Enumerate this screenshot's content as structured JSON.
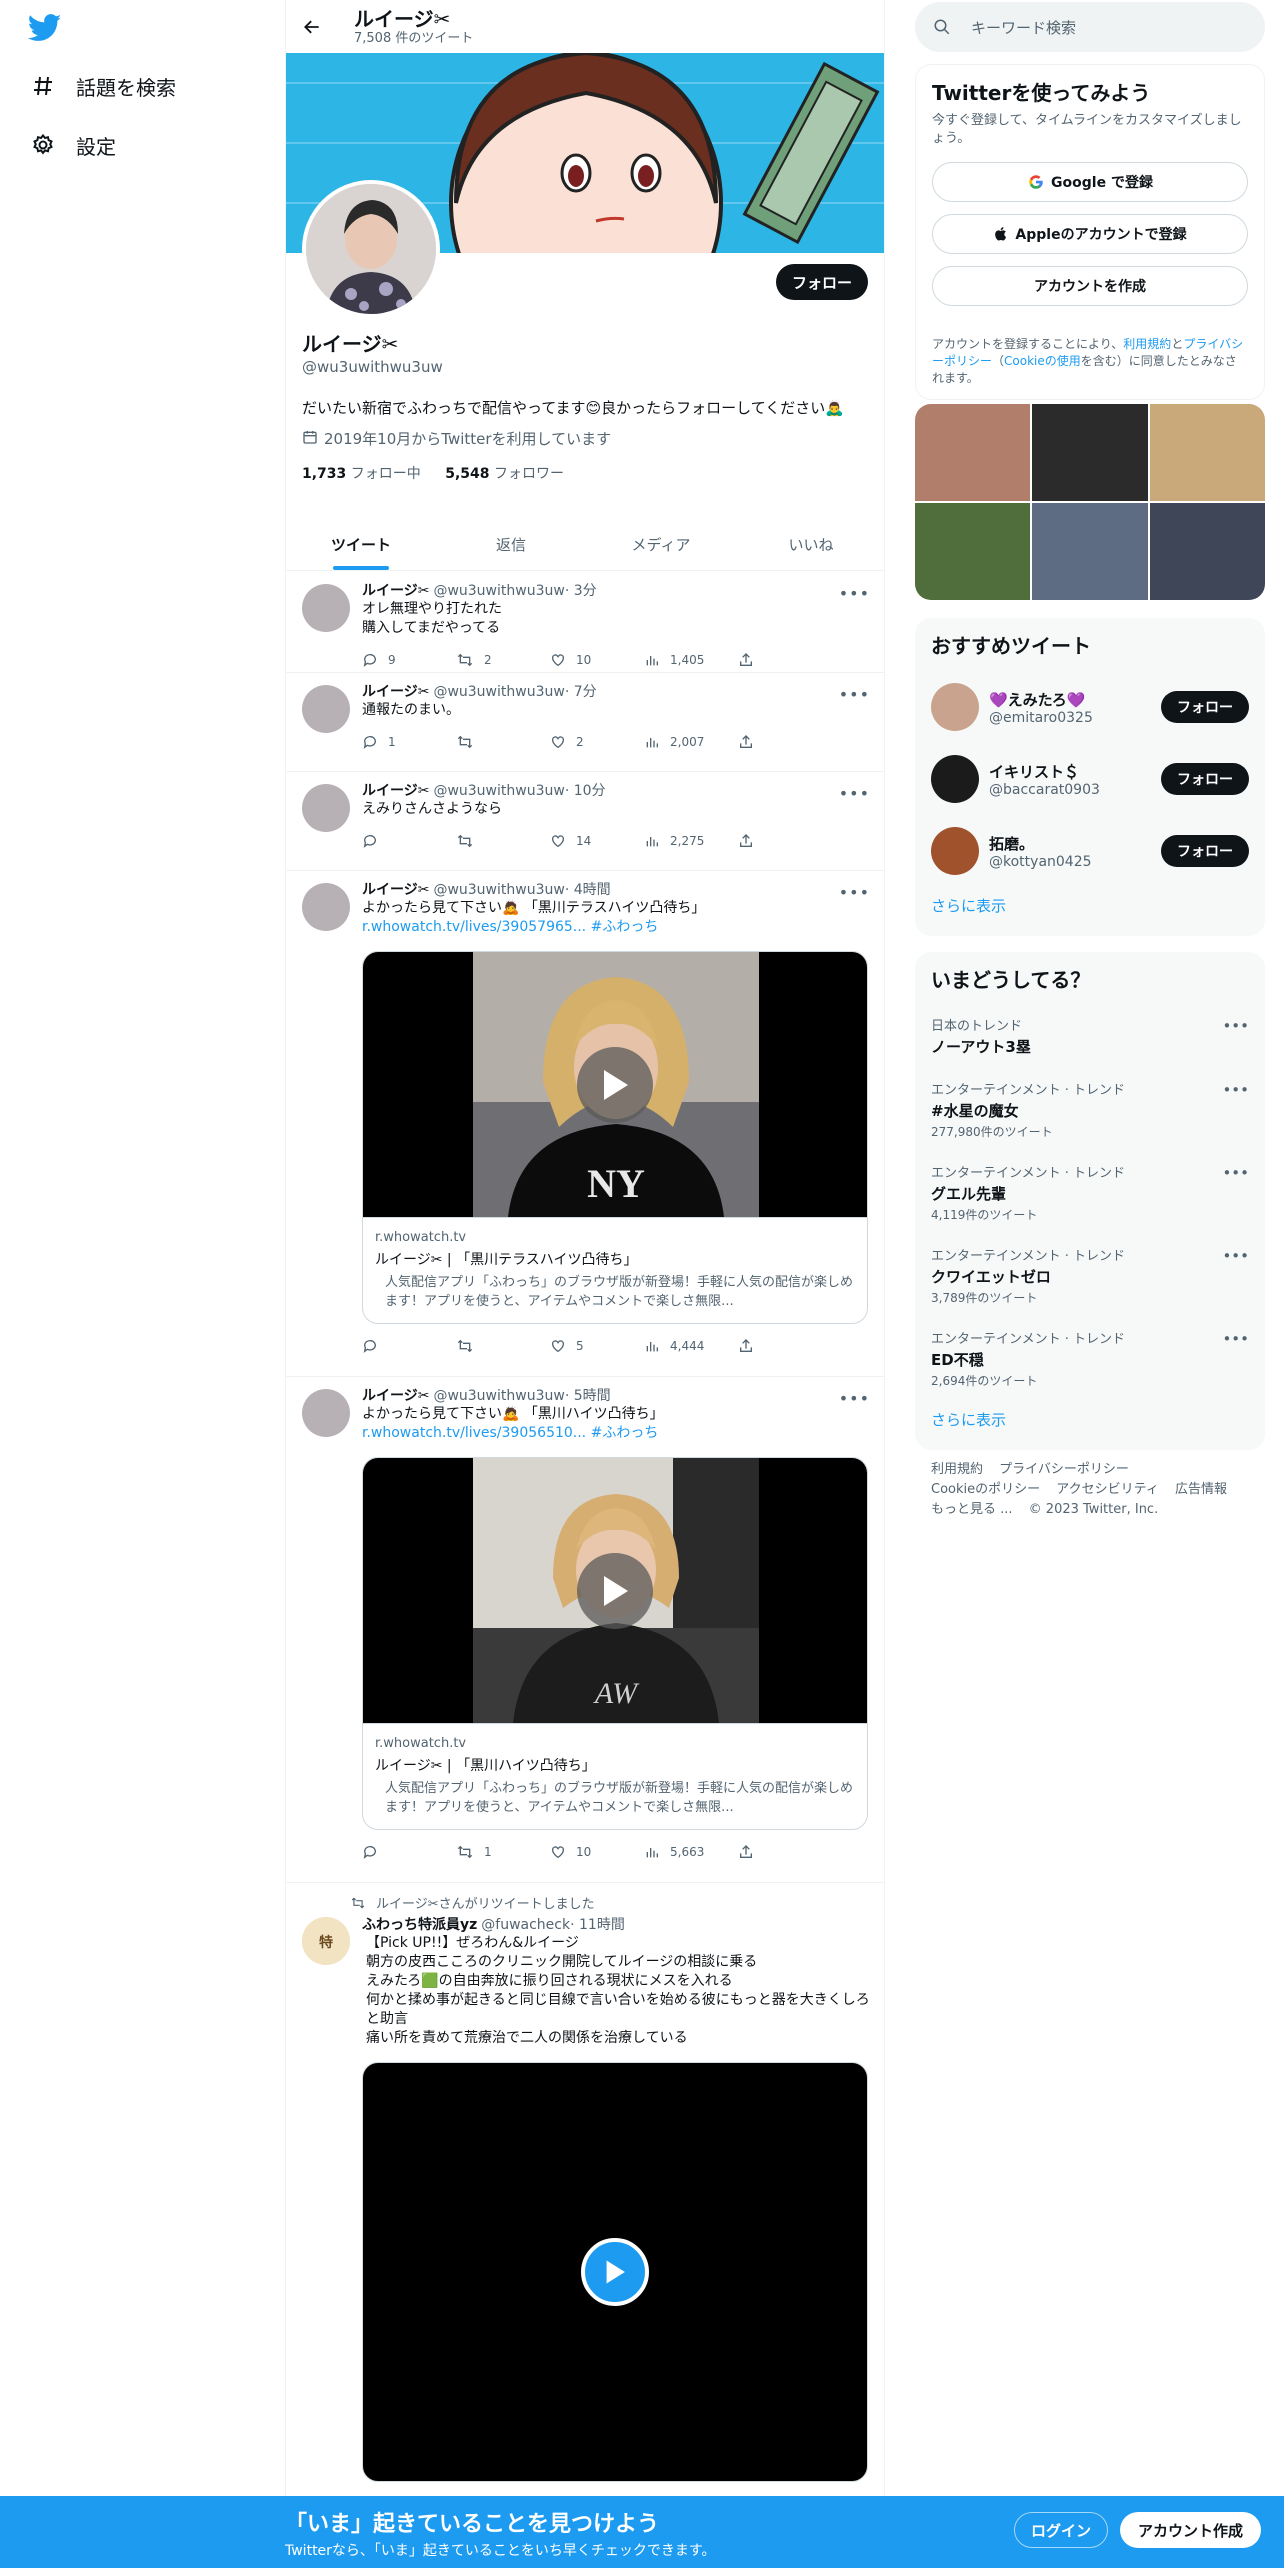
{
  "nav": {
    "explore_label": "話題を検索",
    "settings_label": "設定"
  },
  "header": {
    "name": "ルイージ✂︎",
    "tweet_count": "7,508 件のツイート"
  },
  "profile": {
    "follow_label": "フォロー",
    "name": "ルイージ✂︎",
    "handle": "@wu3uwithwu3uw",
    "bio": "だいたい新宿でふわっちで配信やってます😊良かったらフォローしてください🙇‍♂️",
    "joined": "2019年10月からTwitterを利用しています",
    "following_count": "1,733",
    "following_label": "フォロー中",
    "followers_count": "5,548",
    "followers_label": "フォロワー"
  },
  "tabs": [
    "ツイート",
    "返信",
    "メディア",
    "いいね"
  ],
  "tweets": [
    {
      "name": "ルイージ✂︎",
      "handle": "@wu3uwithwu3uw",
      "time": "· 3分",
      "text": "オレ無理やり打たれた\n購入してまだやってる",
      "replies": "9",
      "retweets": "2",
      "likes": "10",
      "views": "1,405"
    },
    {
      "name": "ルイージ✂︎",
      "handle": "@wu3uwithwu3uw",
      "time": "· 7分",
      "text": "通報たのまい。",
      "replies": "1",
      "retweets": "",
      "likes": "2",
      "views": "2,007"
    },
    {
      "name": "ルイージ✂︎",
      "handle": "@wu3uwithwu3uw",
      "time": "· 10分",
      "text": "えみりさんさようなら",
      "replies": "",
      "retweets": "",
      "likes": "14",
      "views": "2,275"
    },
    {
      "name": "ルイージ✂︎",
      "handle": "@wu3uwithwu3uw",
      "time": "· 4時間",
      "text": "よかったら見て下さい🙇 「黒川テラスハイツ凸待ち」",
      "link": "r.whowatch.tv/lives/39057965...",
      "hashtag": "#ふわっち",
      "card_domain": "r.whowatch.tv",
      "card_title": "ルイージ✂︎ | 「黒川テラスハイツ凸待ち」",
      "card_desc": "人気配信アプリ「ふわっち」のブラウザ版が新登場！手軽に人気の配信が楽しめます！アプリを使うと、アイテムやコメントで楽しさ無限...",
      "replies": "",
      "retweets": "",
      "likes": "5",
      "views": "4,444"
    },
    {
      "name": "ルイージ✂︎",
      "handle": "@wu3uwithwu3uw",
      "time": "· 5時間",
      "text": "よかったら見て下さい🙇 「黒川ハイツ凸待ち」",
      "link": "r.whowatch.tv/lives/39056510...",
      "hashtag": "#ふわっち",
      "card_domain": "r.whowatch.tv",
      "card_title": "ルイージ✂︎ | 「黒川ハイツ凸待ち」",
      "card_desc": "人気配信アプリ「ふわっち」のブラウザ版が新登場！手軽に人気の配信が楽しめます！アプリを使うと、アイテムやコメントで楽しさ無限...",
      "replies": "",
      "retweets": "1",
      "likes": "10",
      "views": "5,663"
    },
    {
      "retweet_note": "ルイージ✂︎さんがリツイートしました",
      "name": "ふわっち特派員yz",
      "handle": "@fuwacheck",
      "time": "· 11時間",
      "text": "【Pick UP!!】ぜろわん&ルイージ\n朝方の皮西こころのクリニック開院してルイージの相談に乗る\nえみたろ🟩の自由奔放に振り回される現状にメスを入れる\n何かと揉め事が起きると同じ目線で言い合いを始める彼にもっと器を大きくしろと助言\n痛い所を責めて荒療治で二人の関係を治療している"
    }
  ],
  "right": {
    "search_placeholder": "キーワード検索",
    "signup_title": "Twitterを使ってみよう",
    "signup_sub": "今すぐ登録して、タイムラインをカスタマイズしましょう。",
    "google_label": "Google で登録",
    "apple_label": "Appleのアカウントで登録",
    "create_label": "アカウントを作成",
    "legal_1": "アカウントを登録することにより、",
    "legal_terms": "利用規約",
    "legal_2": "と",
    "legal_privacy": "プライバシーポリシー",
    "legal_3": "（",
    "legal_cookie": "Cookieの使用",
    "legal_4": "を含む）に同意したとみなされます。",
    "reco_title": "おすすめツイート",
    "reco_users": [
      {
        "name": "💜えみたろ💜",
        "handle": "@emitaro0325",
        "button": "フォロー"
      },
      {
        "name": "イキリスト＄",
        "handle": "@baccarat0903",
        "button": "フォロー"
      },
      {
        "name": "拓磨。",
        "handle": "@kottyan0425",
        "button": "フォロー"
      }
    ],
    "show_more": "さらに表示",
    "trends_title": "いまどうしてる？",
    "trends": [
      {
        "context": "日本のトレンド",
        "name": "ノーアウト3塁",
        "count": ""
      },
      {
        "context": "エンターテインメント · トレンド",
        "name": "#水星の魔女",
        "count": "277,980件のツイート"
      },
      {
        "context": "エンターテインメント · トレンド",
        "name": "グエル先輩",
        "count": "4,119件のツイート"
      },
      {
        "context": "エンターテインメント · トレンド",
        "name": "クワイエットゼロ",
        "count": "3,789件のツイート"
      },
      {
        "context": "エンターテインメント · トレンド",
        "name": "ED不穏",
        "count": "2,694件のツイート"
      }
    ],
    "trends_more": "さらに表示",
    "footer": [
      "利用規約",
      "プライバシーポリシー",
      "Cookieのポリシー",
      "アクセシビリティ",
      "広告情報",
      "もっと見る ...",
      "© 2023 Twitter, Inc."
    ]
  },
  "bottom": {
    "title": "「いま」起きていることを見つけよう",
    "subtitle": "Twitterなら、「いま」起きていることをいち早くチェックできます。",
    "login": "ログイン",
    "signup": "アカウント作成"
  },
  "colors": {
    "accent": "#1d9bf0",
    "text": "#0f1419",
    "muted": "#536471"
  }
}
